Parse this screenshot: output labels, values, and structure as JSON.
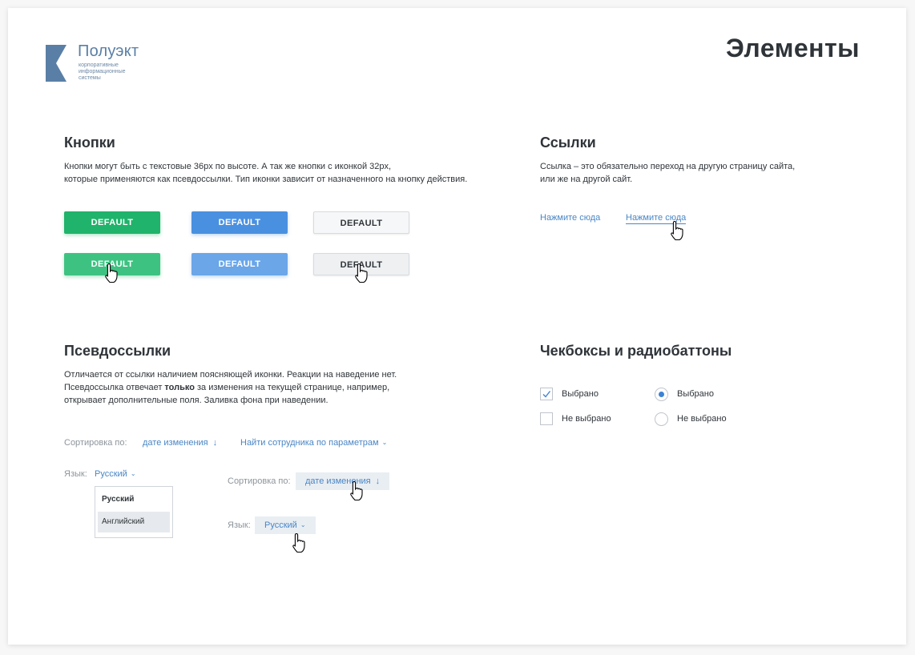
{
  "logo": {
    "name": "Полуэкт",
    "tagline": "корпоративные информационные системы",
    "color": "#5a7fa6"
  },
  "page": {
    "title": "Элементы"
  },
  "buttons_section": {
    "title": "Кнопки",
    "desc_line1": "Кнопки могут быть с текстовые 36px по высоте. А так же кнопки с иконкой 32px,",
    "desc_line2": "которые применяются как псевдоссылки. Тип иконки зависит от назначенного на кнопку действия.",
    "label": "DEFAULT",
    "colors": {
      "green": "#20b36b",
      "blue": "#4a90e0",
      "white": "#f6f7f8"
    }
  },
  "links_section": {
    "title": "Ссылки",
    "desc_line1": "Ссылка – это обязательно переход на другую страницу сайта,",
    "desc_line2": "или же на другой сайт.",
    "link_label": "Нажмите сюда",
    "link_color": "#4a86c5"
  },
  "pseudo_section": {
    "title": "Псевдоссылки",
    "desc_line1": "Отличается от ссылки наличием поясняющей иконки. Реакции на наведение нет.",
    "desc_line2_pre": "Псевдоссылка отвечает ",
    "desc_line2_bold": "только",
    "desc_line2_post": " за изменения на текущей странице, например,",
    "desc_line3": "открывает дополнительные поля. Заливка фона при наведении.",
    "sort_label": "Сортировка по:",
    "sort_value": "дате изменения",
    "find_label": "Найти сотрудника по параметрам",
    "lang_label": "Язык:",
    "lang_value": "Русский",
    "dropdown_options": [
      "Русский",
      "Английский"
    ]
  },
  "checks_section": {
    "title": "Чекбоксы и радиобаттоны",
    "checked_label": "Выбрано",
    "unchecked_label": "Не выбрано",
    "checkbox_checked": true,
    "radio_checked": true
  },
  "icons": {
    "logo": "logo-k-icon",
    "cursor": "hand-pointer-icon",
    "sort_arrow": "arrow-down-icon",
    "dropdown": "chevron-down-icon",
    "check": "checkmark-icon"
  }
}
